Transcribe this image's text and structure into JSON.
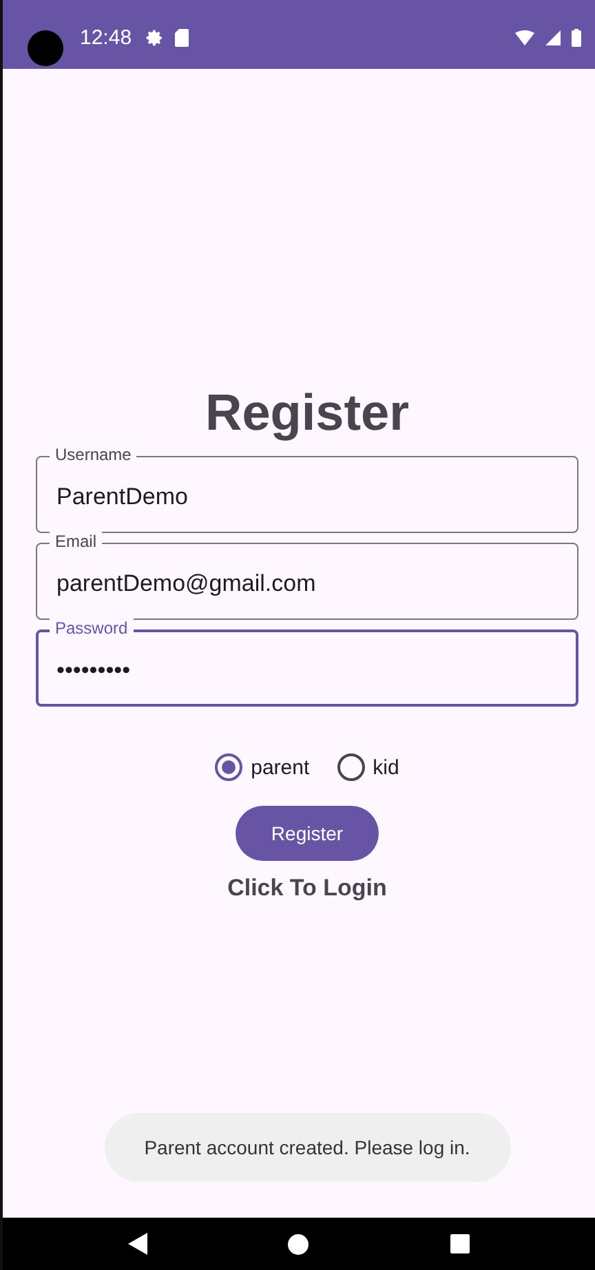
{
  "status_bar": {
    "time": "12:48"
  },
  "title": "Register",
  "fields": [
    {
      "label": "Username",
      "value": "ParentDemo",
      "focused": false
    },
    {
      "label": "Email",
      "value": "parentDemo@gmail.com",
      "focused": false
    },
    {
      "label": "Password",
      "value": "•••••••••",
      "focused": true
    }
  ],
  "roles": [
    {
      "label": "parent",
      "selected": true
    },
    {
      "label": "kid",
      "selected": false
    }
  ],
  "register_button": "Register",
  "login_link": "Click To Login",
  "toast": "Parent account created. Please log in."
}
